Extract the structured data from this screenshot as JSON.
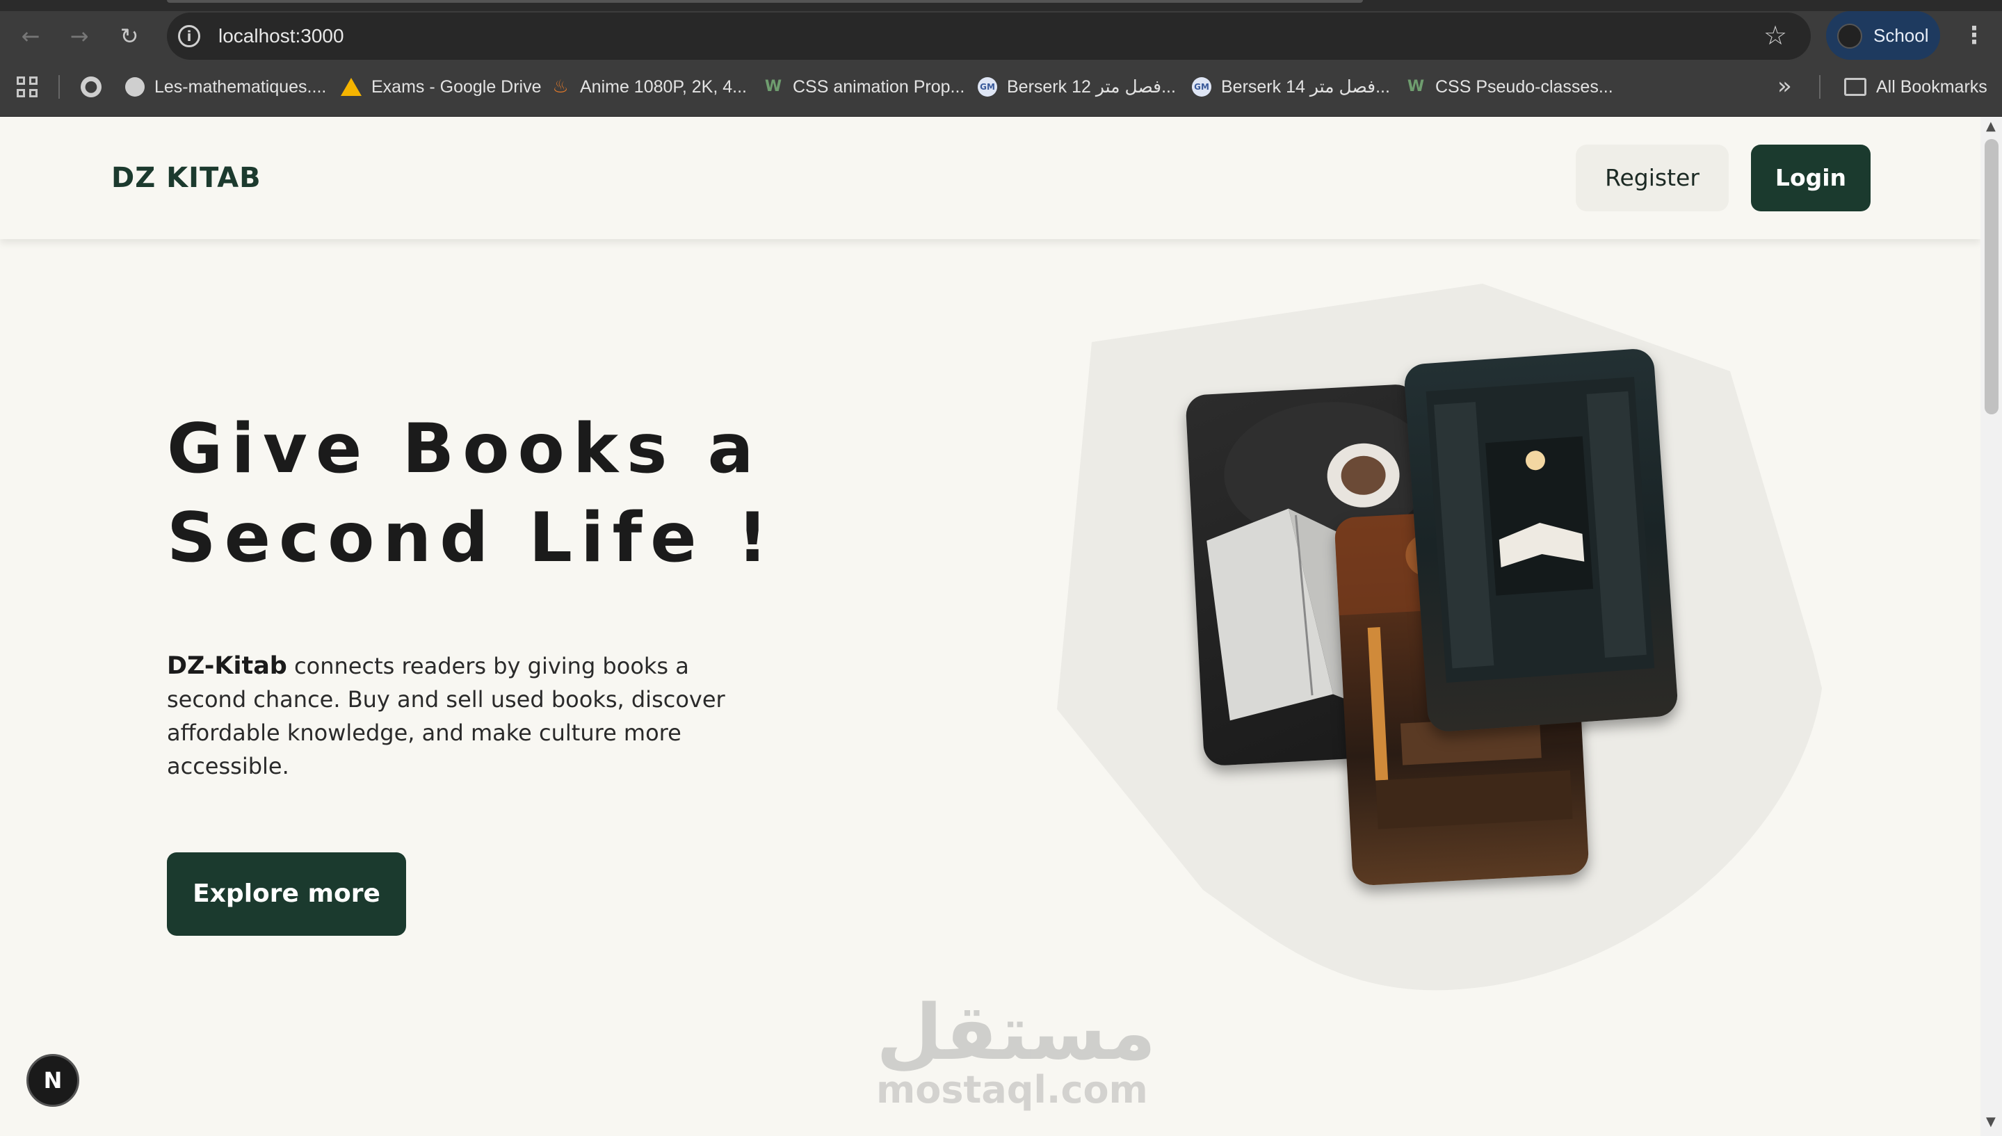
{
  "browser": {
    "url": "localhost:3000",
    "profile_label": "School",
    "bookmarks": [
      {
        "label": "Les-mathematiques....",
        "icon": "globe-icon"
      },
      {
        "label": "Exams - Google Drive",
        "icon": "drive-icon"
      },
      {
        "label": "Anime 1080P, 2K, 4...",
        "icon": "flame-icon"
      },
      {
        "label": "CSS animation Prop...",
        "icon": "w3schools-icon"
      },
      {
        "label": "Berserk 12 فصل متر...",
        "icon": "gm-icon"
      },
      {
        "label": "Berserk 14 فصل متر...",
        "icon": "gm-icon"
      },
      {
        "label": "CSS Pseudo-classes...",
        "icon": "w3schools-icon"
      }
    ],
    "all_bookmarks_label": "All Bookmarks"
  },
  "site": {
    "logo": "DZ KITAB",
    "register_label": "Register",
    "login_label": "Login"
  },
  "hero": {
    "title_line1": "Give Books a",
    "title_line2": "Second Life !",
    "brand": "DZ-Kitab",
    "description": " connects readers by giving books a second chance. Buy and sell used books, discover affordable knowledge, and make culture more accessible.",
    "cta_label": "Explore more"
  },
  "badge": {
    "label": "N"
  },
  "watermark": {
    "arabic": "مستقل",
    "latin": "mostaql.com"
  },
  "colors": {
    "accent": "#1b3a2e",
    "page_bg": "#f8f7f2",
    "chrome_bg": "#3c3c3c"
  }
}
